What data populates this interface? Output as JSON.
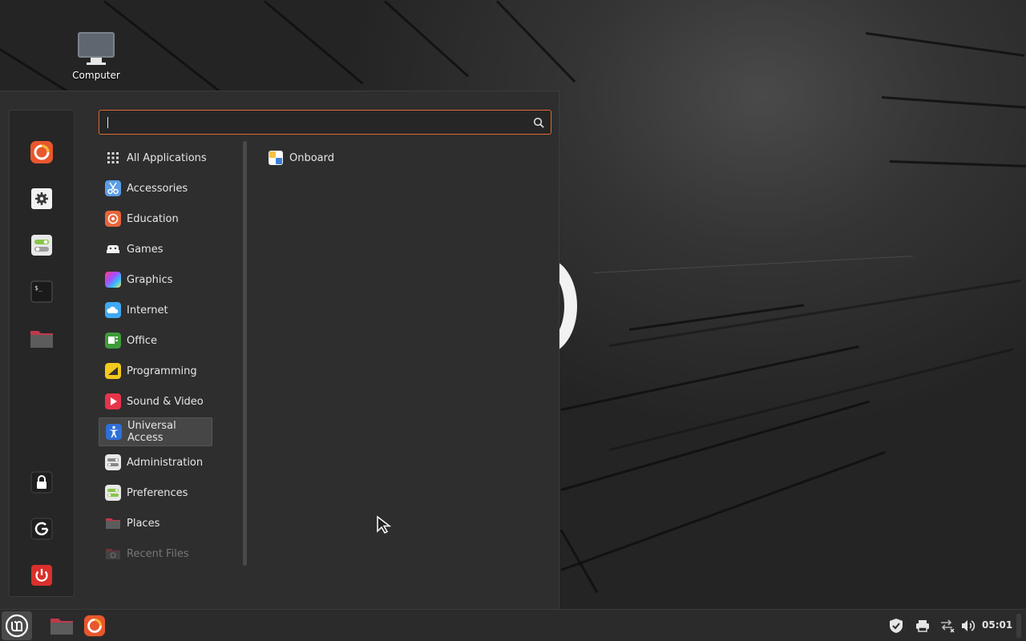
{
  "desktop": {
    "icons": [
      {
        "label": "Computer",
        "icon": "computer-icon"
      }
    ]
  },
  "menu": {
    "search": {
      "value": "",
      "placeholder": "",
      "icon": "search-icon"
    },
    "favorites": [
      {
        "name": "firefox",
        "icon": "firefox-icon"
      },
      {
        "name": "system-settings",
        "icon": "gear-icon"
      },
      {
        "name": "software-manager",
        "icon": "toggles-icon"
      },
      {
        "name": "terminal",
        "icon": "terminal-icon"
      },
      {
        "name": "files",
        "icon": "folder-icon"
      }
    ],
    "session": [
      {
        "name": "lock-screen",
        "icon": "lock-icon"
      },
      {
        "name": "logout",
        "icon": "logout-icon"
      },
      {
        "name": "quit",
        "icon": "power-icon"
      }
    ],
    "categories": [
      {
        "label": "All Applications",
        "icon": "grid-icon"
      },
      {
        "label": "Accessories",
        "icon": "scissors-icon"
      },
      {
        "label": "Education",
        "icon": "education-icon"
      },
      {
        "label": "Games",
        "icon": "gamepad-icon"
      },
      {
        "label": "Graphics",
        "icon": "graphics-icon"
      },
      {
        "label": "Internet",
        "icon": "cloud-icon"
      },
      {
        "label": "Office",
        "icon": "office-icon"
      },
      {
        "label": "Programming",
        "icon": "programming-icon"
      },
      {
        "label": "Sound & Video",
        "icon": "play-icon"
      },
      {
        "label": "Universal Access",
        "icon": "accessibility-icon"
      },
      {
        "label": "Administration",
        "icon": "toggles-icon"
      },
      {
        "label": "Preferences",
        "icon": "preferences-icon"
      },
      {
        "label": "Places",
        "icon": "folder-icon"
      },
      {
        "label": "Recent Files",
        "icon": "recent-files-icon"
      }
    ],
    "selected_category": "Universal Access",
    "apps": [
      {
        "label": "Onboard",
        "icon": "onboard-icon"
      }
    ]
  },
  "panel": {
    "launchers": [
      {
        "name": "files",
        "icon": "folder-icon"
      },
      {
        "name": "firefox",
        "icon": "firefox-icon"
      }
    ],
    "tray": [
      {
        "name": "update-manager",
        "icon": "shield-check-icon"
      },
      {
        "name": "printers",
        "icon": "printer-icon"
      },
      {
        "name": "network",
        "icon": "network-disconnected-icon"
      },
      {
        "name": "volume",
        "icon": "volume-icon"
      }
    ],
    "clock": "05:01"
  },
  "colors": {
    "accent": "#e0692e",
    "menu_bg": "#2e2e2e",
    "panel_bg": "#2b2b2b",
    "selected_bg": "#464646"
  }
}
